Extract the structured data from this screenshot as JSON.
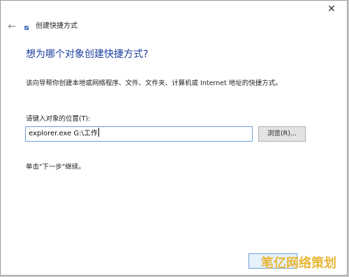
{
  "window": {
    "title": "创建快捷方式",
    "close_glyph": "✕",
    "back_glyph": "←"
  },
  "main": {
    "heading": "想为哪个对象创建快捷方式?",
    "description": "该向导帮你创建本地或网络程序、文件、文件夹、计算机或 Internet 地址的快捷方式。",
    "location_label": "请键入对象的位置(T):",
    "location_value": "explorer.exe G:\\工作",
    "browse_label": "浏览(R)...",
    "hint": "单击\"下一步\"继续。"
  },
  "watermark": {
    "text": "笔亿网络策划"
  },
  "colors": {
    "heading": "#1a3e9c",
    "input_border": "#6d9fd6",
    "watermark": "#e8b634"
  }
}
